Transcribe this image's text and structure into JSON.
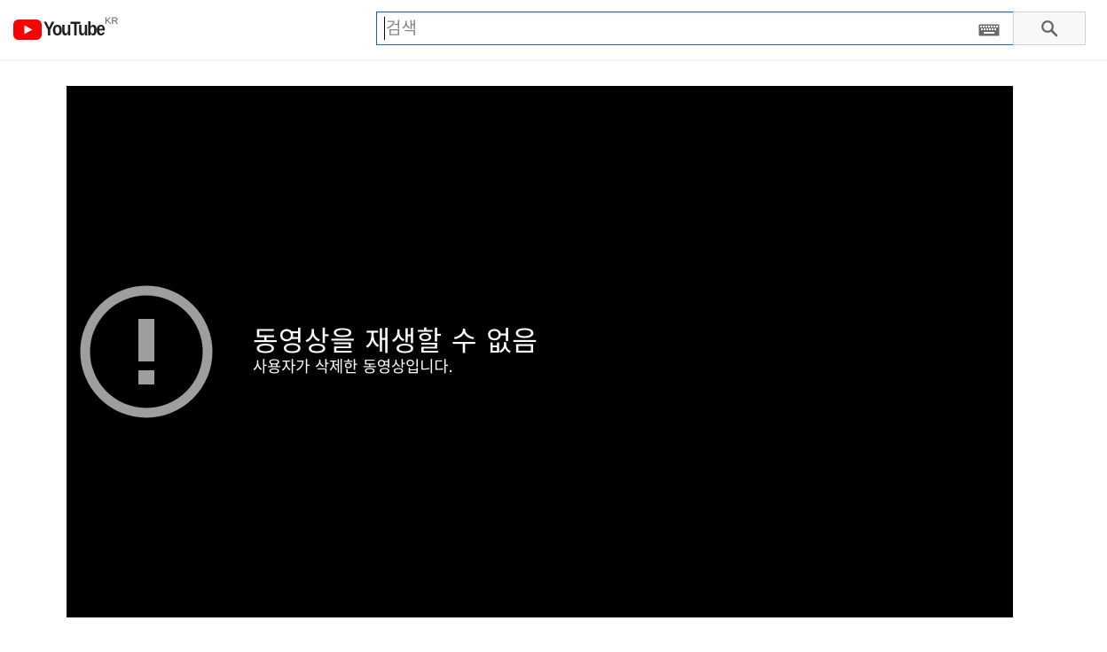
{
  "header": {
    "logo_text": "YouTube",
    "country_code": "KR",
    "search": {
      "placeholder": "검색",
      "value": ""
    },
    "icons": {
      "logo": "youtube-logo-icon",
      "keyboard": "keyboard-icon",
      "search": "search-icon"
    }
  },
  "player": {
    "error_title": "동영상을 재생할 수 없음",
    "error_subtitle": "사용자가 삭제한 동영상입니다.",
    "icon": "alert-icon"
  },
  "colors": {
    "brand_red": "#ff0000",
    "player_bg": "#000000",
    "error_icon": "#9e9e9e",
    "search_border_focus": "#1c62b9"
  }
}
